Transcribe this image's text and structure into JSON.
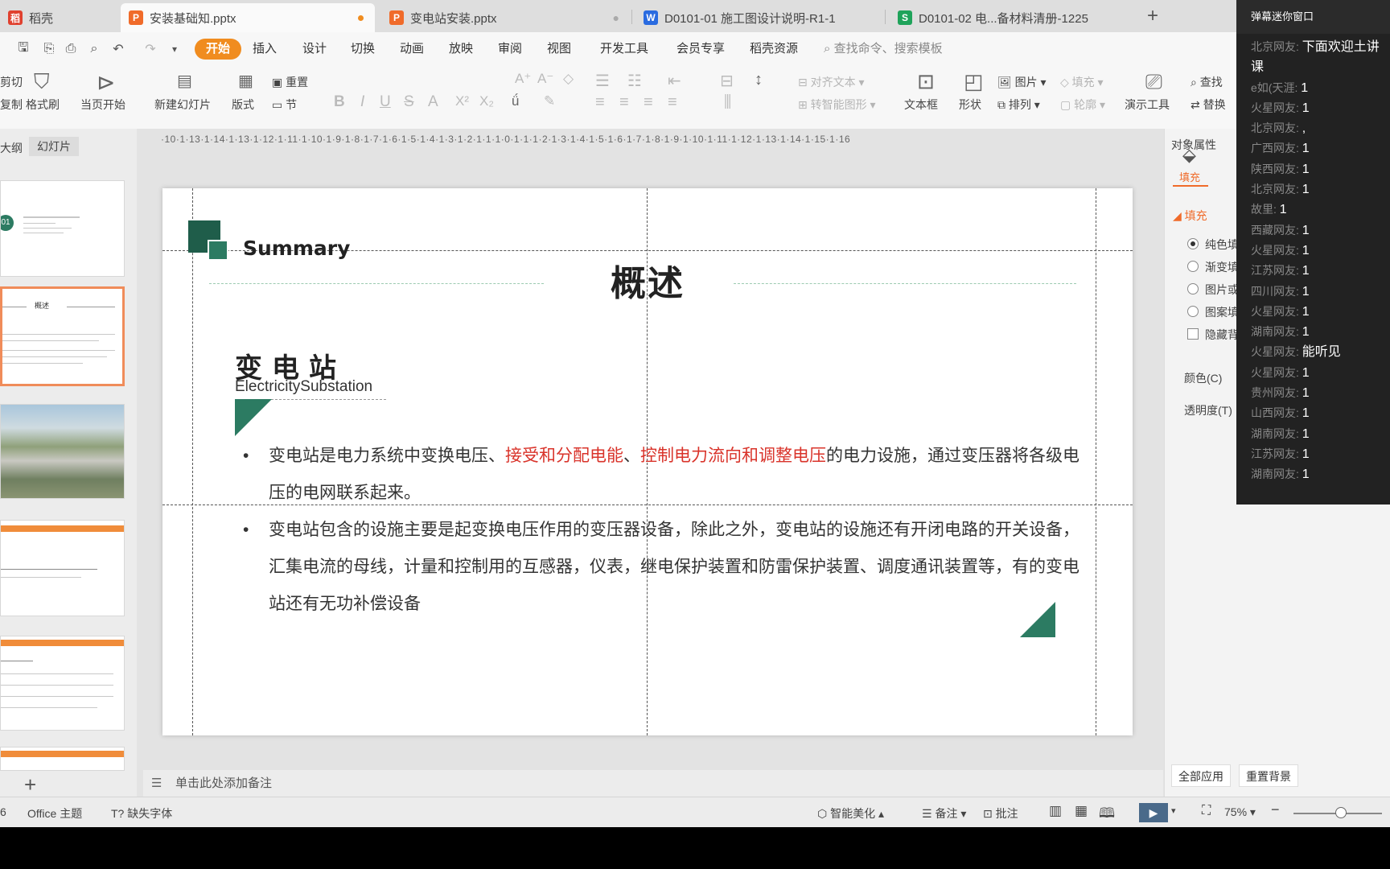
{
  "tabs": [
    {
      "label": "稻壳",
      "icon_color": "#e0412f"
    },
    {
      "label": "安装基础知.pptx",
      "icon_color": "#f06b2a"
    },
    {
      "label": "变电站安装.pptx",
      "icon_color": "#f06b2a"
    },
    {
      "label": "D0101-01 施工图设计说明-R1-1",
      "icon_color": "#2a6be0"
    },
    {
      "label": "D0101-02 电...备材料清册-1225",
      "icon_color": "#1fa35a"
    }
  ],
  "menus": [
    "开始",
    "插入",
    "设计",
    "切换",
    "动画",
    "放映",
    "审阅",
    "视图",
    "开发工具",
    "会员专享",
    "稻壳资源"
  ],
  "cmd_search": "查找命令、搜索模板",
  "ribbon": {
    "cut": "剪切",
    "copy": "复制",
    "format_painter": "格式刷",
    "play_from_current": "当页开始",
    "new_slide": "新建幻灯片",
    "layout": "版式",
    "reset": "重置",
    "section": "节",
    "align_text": "对齐文本",
    "smart_shape": "转智能图形",
    "text_box": "文本框",
    "shape": "形状",
    "picture": "图片",
    "arrange": "排列",
    "fill": "填充",
    "outline": "轮廓",
    "presenter_tools": "演示工具",
    "find": "查找",
    "replace": "替换"
  },
  "panel": {
    "tab_outline": "大纲",
    "tab_slides": "幻灯片",
    "thumb_number": "01",
    "thumb2_title": "概述",
    "slide_count": "6"
  },
  "ruler": "·10·1·13·1·14·1·13·1·12·1·11·1·10·1·9·1·8·1·7·1·6·1·5·1·4·1·3·1·2·1·1·1·0·1·1·1·2·1·3·1·4·1·5·1·6·1·7·1·8·1·9·1·10·1·11·1·12·1·13·1·14·1·15·1·16",
  "slide": {
    "summary": "Summary",
    "title": "概述",
    "subtitle_cn": "变电站",
    "subtitle_en": "ElectricitySubstation",
    "bullet1": {
      "p1": "变电站是电力系统中变换电压、",
      "p2": "接受和分配电能",
      "p3": "、",
      "p4": "控制电力流向和调整电压",
      "p5": "的电力设施，通过变压器将各级电压的电网联系起来。"
    },
    "bullet2": "变电站包含的设施主要是起变换电压作用的变压器设备，除此之外，变电站的设施还有开闭电路的开关设备，汇集电流的母线，计量和控制用的互感器，仪表，继电保护装置和防雷保护装置、调度通讯装置等，有的变电站还有无功补偿设备"
  },
  "notes_placeholder": "单击此处添加备注",
  "props": {
    "header": "对象属性",
    "fill_tab": "填充",
    "fill_section": "填充",
    "options": [
      "纯色填充",
      "渐变填充",
      "图片或纹理填充",
      "图案填充"
    ],
    "hide_bg": "隐藏背景图形",
    "color": "颜色(C)",
    "transparency": "透明度(T)",
    "apply_all": "全部应用",
    "reset_bg": "重置背景"
  },
  "status": {
    "theme": "Office 主题",
    "missing_font": "缺失字体",
    "beautify": "智能美化",
    "notes": "备注",
    "comments": "批注",
    "zoom": "75%"
  },
  "chat": {
    "header": "弹幕迷你窗口",
    "messages": [
      {
        "name": "北京网友:",
        "text": "下面欢迎土讲"
      },
      {
        "name": "",
        "text": "课"
      },
      {
        "name": "e如(天涯:",
        "text": "1"
      },
      {
        "name": "火星网友:",
        "text": "1"
      },
      {
        "name": "北京网友:",
        "text": ","
      },
      {
        "name": "广西网友:",
        "text": "1"
      },
      {
        "name": "陕西网友:",
        "text": "1"
      },
      {
        "name": "北京网友:",
        "text": "1"
      },
      {
        "name": "故里:",
        "text": "1"
      },
      {
        "name": "西藏网友:",
        "text": "1"
      },
      {
        "name": "火星网友:",
        "text": "1"
      },
      {
        "name": "江苏网友:",
        "text": "1"
      },
      {
        "name": "四川网友:",
        "text": "1"
      },
      {
        "name": "火星网友:",
        "text": "1"
      },
      {
        "name": "湖南网友:",
        "text": "1"
      },
      {
        "name": "火星网友:",
        "text": "能听见"
      },
      {
        "name": "火星网友:",
        "text": "1"
      },
      {
        "name": "贵州网友:",
        "text": "1"
      },
      {
        "name": "山西网友:",
        "text": "1"
      },
      {
        "name": "湖南网友:",
        "text": "1"
      },
      {
        "name": "江苏网友:",
        "text": "1"
      },
      {
        "name": "湖南网友:",
        "text": "1"
      }
    ]
  }
}
